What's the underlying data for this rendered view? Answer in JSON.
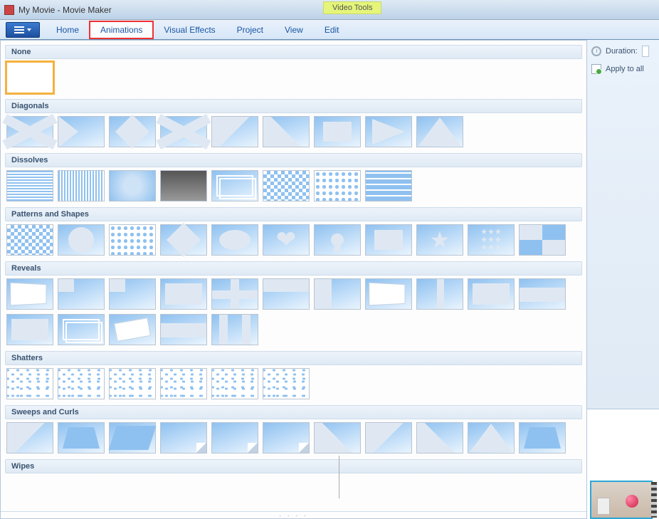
{
  "window": {
    "title": "My Movie - Movie Maker",
    "context_tab": "Video Tools"
  },
  "tabs": {
    "home": "Home",
    "animations": "Animations",
    "visual_effects": "Visual Effects",
    "project": "Project",
    "view": "View",
    "edit": "Edit",
    "active": "animations",
    "highlighted": "animations"
  },
  "side": {
    "duration_label": "Duration:",
    "apply_all_label": "Apply to all"
  },
  "gallery": {
    "categories": [
      {
        "id": "none",
        "label": "None",
        "items": [
          {
            "id": "none",
            "style": "none",
            "selected": true
          }
        ]
      },
      {
        "id": "diagonals",
        "label": "Diagonals",
        "items": [
          {
            "id": "diag-bowtie",
            "style": "x"
          },
          {
            "id": "diag-hourglass",
            "style": "tri-l"
          },
          {
            "id": "diag-diamond",
            "style": "diamond"
          },
          {
            "id": "diag-cross",
            "style": "x"
          },
          {
            "id": "diag-down-right",
            "style": "diag"
          },
          {
            "id": "diag-down-left",
            "style": "diag2"
          },
          {
            "id": "diag-box-out",
            "style": "rect"
          },
          {
            "id": "diag-arrow-left",
            "style": "arrow"
          },
          {
            "id": "diag-triangle-up",
            "style": "tri-up"
          }
        ]
      },
      {
        "id": "dissolves",
        "label": "Dissolves",
        "items": [
          {
            "id": "dis-h-blinds",
            "style": "hlines"
          },
          {
            "id": "dis-v-blinds",
            "style": "vlines"
          },
          {
            "id": "dis-blur",
            "style": "blur"
          },
          {
            "id": "dis-fade-black",
            "style": "photo"
          },
          {
            "id": "dis-crossfade",
            "style": "stack"
          },
          {
            "id": "dis-pixelate",
            "style": "checker"
          },
          {
            "id": "dis-dissolve",
            "style": "dots"
          },
          {
            "id": "dis-bricks",
            "style": "bricks"
          }
        ]
      },
      {
        "id": "patterns",
        "label": "Patterns and Shapes",
        "items": [
          {
            "id": "pat-checker",
            "style": "checker"
          },
          {
            "id": "pat-circle",
            "style": "circle"
          },
          {
            "id": "pat-circles",
            "style": "dots"
          },
          {
            "id": "pat-diamond",
            "style": "diamond"
          },
          {
            "id": "pat-oval",
            "style": "oval"
          },
          {
            "id": "pat-heart",
            "style": "heart"
          },
          {
            "id": "pat-keyhole",
            "style": "keyhole"
          },
          {
            "id": "pat-rect",
            "style": "rect"
          },
          {
            "id": "pat-star",
            "style": "star"
          },
          {
            "id": "pat-stars",
            "style": "stars"
          },
          {
            "id": "pat-pinwheel",
            "style": "pinwheel"
          }
        ]
      },
      {
        "id": "reveals",
        "label": "Reveals",
        "items": [
          {
            "id": "rev-page-3d",
            "style": "page"
          },
          {
            "id": "rev-corner",
            "style": "corner"
          },
          {
            "id": "rev-inset-tl",
            "style": "corner"
          },
          {
            "id": "rev-inset",
            "style": "inset"
          },
          {
            "id": "rev-cross",
            "style": "cross"
          },
          {
            "id": "rev-split-h",
            "style": "split-h"
          },
          {
            "id": "rev-split-v",
            "style": "split-v"
          },
          {
            "id": "rev-flip",
            "style": "page"
          },
          {
            "id": "rev-col",
            "style": "col"
          },
          {
            "id": "rev-frame",
            "style": "inset"
          },
          {
            "id": "rev-bars-h",
            "style": "hbars"
          },
          {
            "id": "rev-inset2",
            "style": "inset"
          },
          {
            "id": "rev-frame2",
            "style": "stack"
          },
          {
            "id": "rev-tilt",
            "style": "tilt"
          },
          {
            "id": "rev-hbars2",
            "style": "hbars"
          },
          {
            "id": "rev-vbars",
            "style": "vbars"
          }
        ]
      },
      {
        "id": "shatters",
        "label": "Shatters",
        "items": [
          {
            "id": "sha-1",
            "style": "scatter"
          },
          {
            "id": "sha-2",
            "style": "scatter"
          },
          {
            "id": "sha-3",
            "style": "scatter"
          },
          {
            "id": "sha-4",
            "style": "scatter"
          },
          {
            "id": "sha-5",
            "style": "scatter"
          },
          {
            "id": "sha-6",
            "style": "scatter"
          }
        ]
      },
      {
        "id": "sweeps",
        "label": "Sweeps and Curls",
        "items": [
          {
            "id": "swp-1",
            "style": "diag"
          },
          {
            "id": "swp-2",
            "style": "trap"
          },
          {
            "id": "swp-3",
            "style": "skew"
          },
          {
            "id": "swp-4",
            "style": "curl"
          },
          {
            "id": "swp-5",
            "style": "curl"
          },
          {
            "id": "swp-6",
            "style": "curl"
          },
          {
            "id": "swp-7",
            "style": "diag2"
          },
          {
            "id": "swp-8",
            "style": "diag"
          },
          {
            "id": "swp-9",
            "style": "diag2"
          },
          {
            "id": "swp-10",
            "style": "tri-up"
          },
          {
            "id": "swp-11",
            "style": "trap"
          }
        ]
      },
      {
        "id": "wipes",
        "label": "Wipes",
        "items": []
      }
    ]
  }
}
